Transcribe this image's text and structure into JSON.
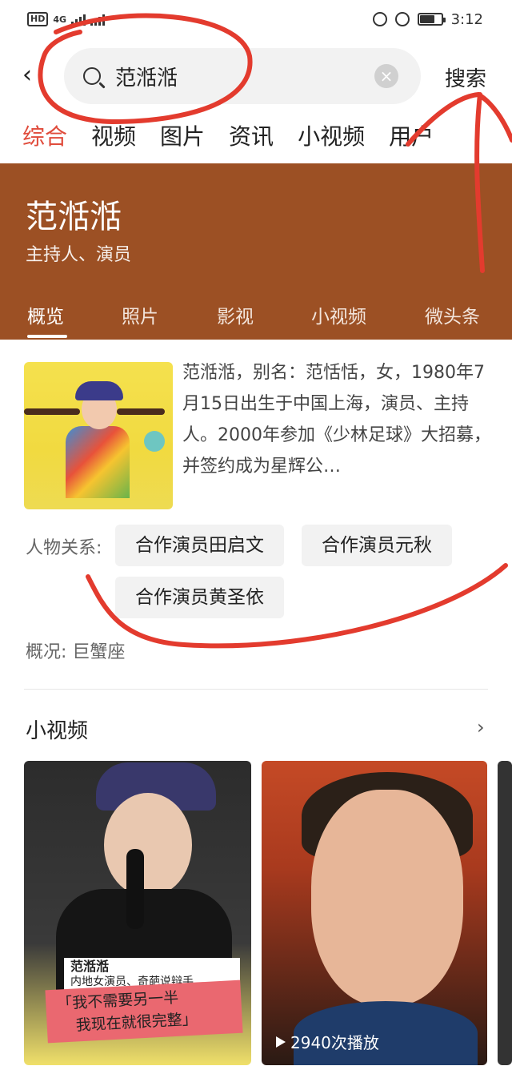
{
  "status_bar": {
    "left_text": "HD",
    "network": "4G",
    "time": "3:12"
  },
  "search": {
    "query": "范湉湉",
    "button_label": "搜索"
  },
  "tabs": [
    "综合",
    "视频",
    "图片",
    "资讯",
    "小视频",
    "用户"
  ],
  "banner": {
    "name": "范湉湉",
    "role": "主持人、演员",
    "subtabs": [
      "概览",
      "照片",
      "影视",
      "小视频",
      "微头条"
    ]
  },
  "profile": {
    "bio": "范湉湉，别名：范恬恬，女，1980年7月15日出生于中国上海，演员、主持人。2000年参加《少林足球》大招募，并签约成为星辉公…",
    "relations_label": "人物关系:",
    "relations": [
      "合作演员田启文",
      "合作演员元秋",
      "合作演员黄圣依"
    ],
    "info_label": "概况:",
    "info_value": "巨蟹座"
  },
  "short_videos": {
    "title": "小视频",
    "card1": {
      "name_tag": "范湉湉",
      "sub_tag": "内地女演员、奇葩说辩手",
      "quote_line1": "「我不需要另一半",
      "quote_line2": "我现在就很完整」"
    },
    "card2": {
      "play_count": "2940次播放"
    }
  },
  "colors": {
    "accent_red": "#e04c3c",
    "banner_brown": "#9c5024",
    "annotation_red": "#e33b2e"
  }
}
